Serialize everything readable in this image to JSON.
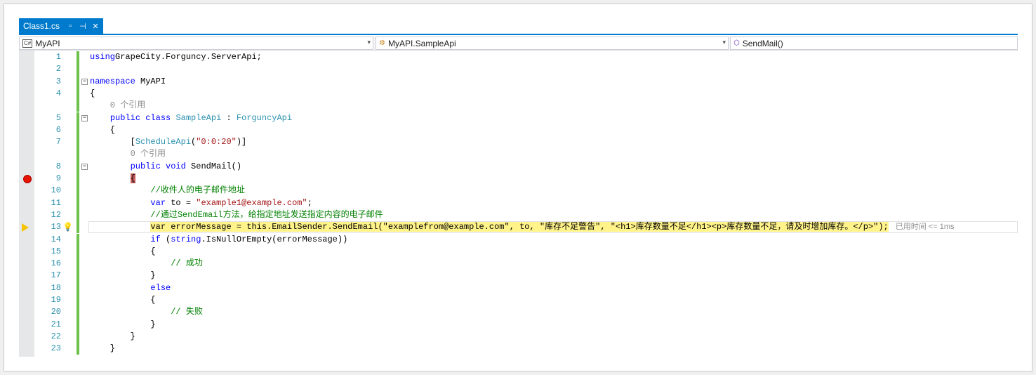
{
  "tab": {
    "title": "Class1.cs",
    "pin_icon": "pin-icon",
    "close_icon": "close-icon"
  },
  "navbar": {
    "project": "MyAPI",
    "type": "MyAPI.SampleApi",
    "member": "SendMail()"
  },
  "lines": [
    {
      "n": "1",
      "tokens": [
        [
          "kw",
          "using"
        ],
        [
          "",
          "GrapeCity.Forguncy.ServerApi;"
        ]
      ]
    },
    {
      "n": "2",
      "tokens": []
    },
    {
      "n": "3",
      "fold": "−",
      "tokens": [
        [
          "kw",
          "namespace"
        ],
        [
          "",
          " MyAPI"
        ]
      ]
    },
    {
      "n": "4",
      "tokens": [
        [
          "",
          "{"
        ]
      ]
    },
    {
      "n": "",
      "lens": true,
      "tokens": [
        [
          "",
          "    0 个引用"
        ]
      ]
    },
    {
      "n": "5",
      "fold": "−",
      "tokens": [
        [
          "",
          "    "
        ],
        [
          "kw",
          "public"
        ],
        [
          "",
          " "
        ],
        [
          "kw",
          "class"
        ],
        [
          "",
          " "
        ],
        [
          "ty",
          "SampleApi"
        ],
        [
          "",
          " : "
        ],
        [
          "ty",
          "ForguncyApi"
        ]
      ]
    },
    {
      "n": "6",
      "tokens": [
        [
          "",
          "    {"
        ]
      ]
    },
    {
      "n": "7",
      "tokens": [
        [
          "",
          "        ["
        ],
        [
          "ty",
          "ScheduleApi"
        ],
        [
          "",
          "("
        ],
        [
          "str",
          "\"0:0:20\""
        ],
        [
          "",
          ")]"
        ]
      ]
    },
    {
      "n": "",
      "lens": true,
      "tokens": [
        [
          "",
          "        0 个引用"
        ]
      ]
    },
    {
      "n": "8",
      "fold": "−",
      "tokens": [
        [
          "",
          "        "
        ],
        [
          "kw",
          "public"
        ],
        [
          "",
          " "
        ],
        [
          "kw",
          "void"
        ],
        [
          "",
          " SendMail()"
        ]
      ]
    },
    {
      "n": "9",
      "breakpoint": true,
      "tokens": [
        [
          "",
          "        "
        ],
        [
          "bpbrace",
          "{"
        ]
      ]
    },
    {
      "n": "10",
      "tokens": [
        [
          "cm",
          "            //收件人的电子邮件地址"
        ]
      ]
    },
    {
      "n": "11",
      "tokens": [
        [
          "",
          "            "
        ],
        [
          "kw",
          "var"
        ],
        [
          "",
          " to = "
        ],
        [
          "str",
          "\"example1@example.com\""
        ],
        [
          "",
          ";"
        ]
      ]
    },
    {
      "n": "12",
      "tokens": [
        [
          "cm",
          "            //通过SendEmail方法，给指定地址发送指定内容的电子邮件"
        ]
      ]
    },
    {
      "n": "13",
      "current": true,
      "tokens": [
        [
          "",
          "            "
        ],
        [
          "hl",
          "var errorMessage = this.EmailSender.SendEmail(\"examplefrom@example.com\", to, \"库存不足警告\", \"<h1>库存数量不足</h1><p>库存数量不足，请及时增加库存。</p>\");"
        ]
      ],
      "perf": "已用时间 <= 1ms"
    },
    {
      "n": "14",
      "tokens": [
        [
          "",
          "            "
        ],
        [
          "kw",
          "if"
        ],
        [
          "",
          " ("
        ],
        [
          "kw",
          "string"
        ],
        [
          "",
          ".IsNullOrEmpty(errorMessage))"
        ]
      ]
    },
    {
      "n": "15",
      "tokens": [
        [
          "",
          "            {"
        ]
      ]
    },
    {
      "n": "16",
      "tokens": [
        [
          "cm",
          "                // 成功"
        ]
      ]
    },
    {
      "n": "17",
      "tokens": [
        [
          "",
          "            }"
        ]
      ]
    },
    {
      "n": "18",
      "tokens": [
        [
          "",
          "            "
        ],
        [
          "kw",
          "else"
        ]
      ]
    },
    {
      "n": "19",
      "tokens": [
        [
          "",
          "            {"
        ]
      ]
    },
    {
      "n": "20",
      "tokens": [
        [
          "cm",
          "                // 失败"
        ]
      ]
    },
    {
      "n": "21",
      "tokens": [
        [
          "",
          "            }"
        ]
      ]
    },
    {
      "n": "22",
      "tokens": [
        [
          "",
          "        }"
        ]
      ]
    },
    {
      "n": "23",
      "tokens": [
        [
          "",
          "    }"
        ]
      ]
    }
  ]
}
